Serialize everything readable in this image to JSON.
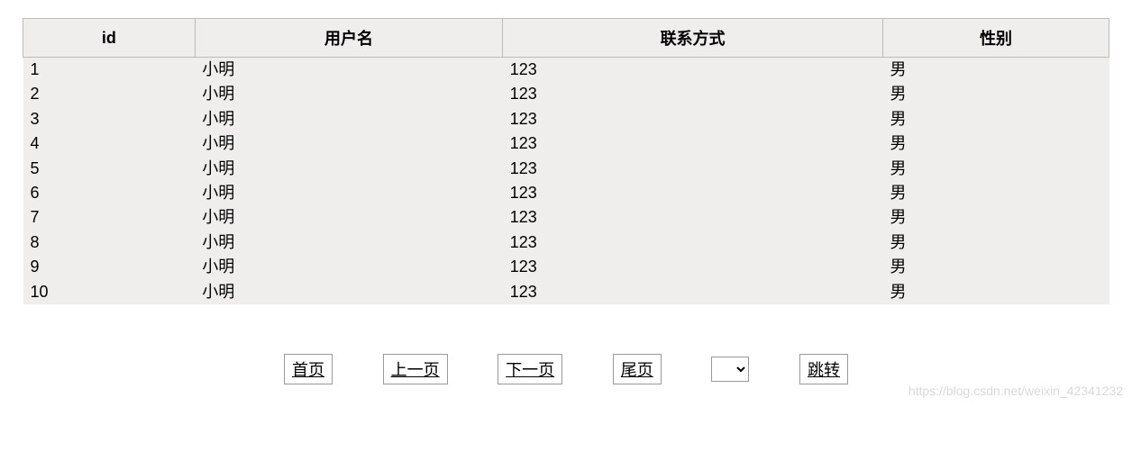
{
  "table": {
    "headers": [
      "id",
      "用户名",
      "联系方式",
      "性别"
    ],
    "rows": [
      {
        "id": "1",
        "username": "小明",
        "contact": "123",
        "gender": "男"
      },
      {
        "id": "2",
        "username": "小明",
        "contact": "123",
        "gender": "男"
      },
      {
        "id": "3",
        "username": "小明",
        "contact": "123",
        "gender": "男"
      },
      {
        "id": "4",
        "username": "小明",
        "contact": "123",
        "gender": "男"
      },
      {
        "id": "5",
        "username": "小明",
        "contact": "123",
        "gender": "男"
      },
      {
        "id": "6",
        "username": "小明",
        "contact": "123",
        "gender": "男"
      },
      {
        "id": "7",
        "username": "小明",
        "contact": "123",
        "gender": "男"
      },
      {
        "id": "8",
        "username": "小明",
        "contact": "123",
        "gender": "男"
      },
      {
        "id": "9",
        "username": "小明",
        "contact": "123",
        "gender": "男"
      },
      {
        "id": "10",
        "username": "小明",
        "contact": "123",
        "gender": "男"
      }
    ]
  },
  "pagination": {
    "first": "首页",
    "prev": "上一页",
    "next": "下一页",
    "last": "尾页",
    "jump": "跳转"
  },
  "watermark": "https://blog.csdn.net/weixin_42341232"
}
